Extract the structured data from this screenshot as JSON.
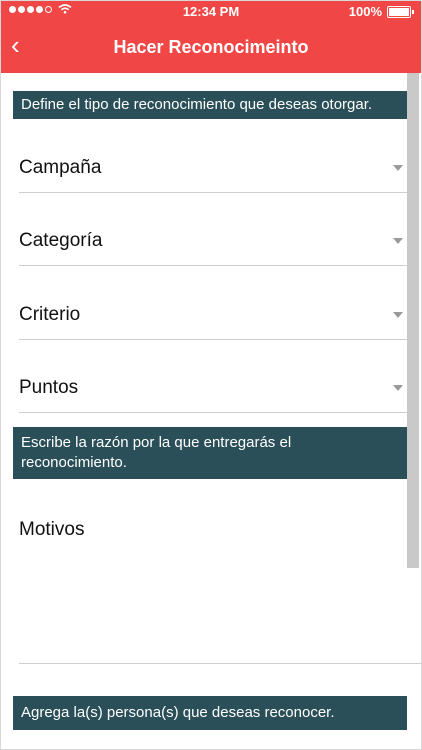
{
  "status_bar": {
    "time": "12:34 PM",
    "battery": "100%"
  },
  "header": {
    "title": "Hacer Reconocimeinto",
    "back_icon": "‹"
  },
  "banners": {
    "type_prompt": "Define el tipo de reconocimiento que deseas otorgar.",
    "reason_prompt": "Escribe la razón por la que entregarás el reconocimiento.",
    "people_prompt": "Agrega la(s) persona(s) que deseas reconocer."
  },
  "fields": {
    "campaign": "Campaña",
    "category": "Categoría",
    "criterion": "Criterio",
    "points": "Puntos",
    "reasons": "Motivos"
  },
  "colors": {
    "header_bg": "#f14646",
    "banner_bg": "#2a4f59"
  }
}
